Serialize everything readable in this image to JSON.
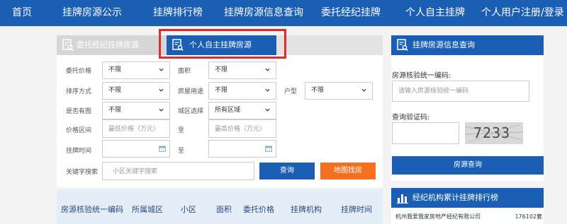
{
  "topnav": {
    "items": [
      "首页",
      "挂牌房源公示",
      "挂牌排行榜",
      "挂牌房源信息查询",
      "委托经纪挂牌",
      "个人自主挂牌",
      "个人用户注册/登录"
    ]
  },
  "search_panel": {
    "tab_inactive": "委托经纪挂牌房源",
    "tab_active": "个人自主挂牌房源",
    "filters": {
      "price_label": "委托价格",
      "price_value": "不限",
      "area_label": "面积",
      "area_value": "不限",
      "sort_label": "排序方式",
      "sort_value": "不限",
      "usage_label": "房屋用途",
      "usage_value": "不限",
      "layout_label": "户型",
      "layout_value": "不限",
      "photo_label": "是否有图",
      "photo_value": "不限",
      "district_label": "城区选择",
      "district_value": "所有区域",
      "price_range_label": "价格区间",
      "price_min_placeholder": "最低价格（万元）",
      "to_label": "至",
      "price_max_placeholder": "最高价格（万元）",
      "time_label": "挂牌时间",
      "keyword_label": "关键字搜索",
      "keyword_placeholder": "小区关键字搜索"
    },
    "query_button": "查询",
    "map_button": "地图找房",
    "table_headers": [
      "房源核验统一编码",
      "所属城区",
      "小区",
      "面积",
      "委托价格",
      "挂牌机构",
      "挂牌时间"
    ]
  },
  "info_panel": {
    "title": "挂牌房源信息查询",
    "code_label": "房源核验统一编码:",
    "code_placeholder": "请输入房源核验统一编码",
    "captcha_label": "查询验证码:",
    "captcha_text": "7233",
    "submit_button": "房源查询"
  },
  "ranking_panel": {
    "title": "经纪机构累计挂牌排行榜",
    "rows": [
      {
        "name": "杭州我爱我家房地产经纪有限公司",
        "count": "176102套"
      }
    ]
  },
  "colors": {
    "brand_blue": "#1a5fb4",
    "orange": "#f36f21",
    "highlight_red": "#e8262b"
  }
}
